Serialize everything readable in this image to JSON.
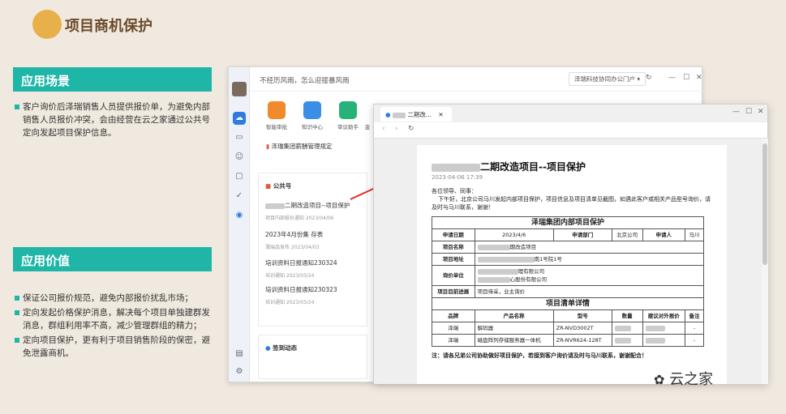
{
  "header": {
    "title": "项目商机保护"
  },
  "scenario": {
    "heading": "应用场景",
    "bullets": [
      "客户询价后泽瑞销售人员提供报价单，为避免内部销售人员报价冲突，会由经营在云之家通过公共号定向发起项目保护信息。"
    ]
  },
  "value": {
    "heading": "应用价值",
    "bullets": [
      "保证公司报价规范，避免内部报价扰乱市场；",
      "定向发起价格保护消息，解决每个项目单独建群发消息，群组利用率不高，减少管理群组的精力；",
      "定向项目保护，更有利于项目销售阶段的保密，避免泄露商机。"
    ]
  },
  "app": {
    "slogan": "不经历风雨，怎么迎接暴风雨",
    "org": "泽瑞科技协同办公门户",
    "apps": [
      "智能审批",
      "知识中心",
      "审议助手",
      "金"
    ],
    "notice": "泽瑞集团薪酬管理规定",
    "public_account": "公共号",
    "items": [
      {
        "title": "二期改造项目--项目保护",
        "sub": "项目内部报价通知  2023/04/06"
      },
      {
        "title": "2023年4月份集  存表",
        "sub": "薄瑞品发布  2023/04/03"
      },
      {
        "title": "培训资料日报通知230324",
        "sub": "培训通知  2023/03/24"
      },
      {
        "title": "培训资料日报通知230323",
        "sub": "培训通知  2023/03/24"
      }
    ],
    "checkin": "签到动态"
  },
  "popup": {
    "tab": "二期改...",
    "doc_title": "二期改造项目--项目保护",
    "doc_date": "2023-04-06 17:39",
    "greeting": "各位领导、同事：",
    "body": "下午好，北京公司马川发起内部项目保护，项目信息及项目清单见截图，如遇此客户或相关产品型号询价，请及时与马川联系，谢谢！",
    "table_title": "泽瑞集团内部项目保护",
    "labels": {
      "apply_date": "申请日期",
      "date": "2023/4/6",
      "dept": "申请部门",
      "dept_val": "北京公司",
      "applicant": "申请人",
      "applicant_val": "马川",
      "project_name": "项目名称",
      "project_name_val": "期改造项目",
      "project_addr": "项目地址",
      "project_addr_val": "南1号院1号",
      "inquiry": "询价单位",
      "inquiry_val1": "理有限公司",
      "inquiry_val2": "心股份有限公司",
      "progress": "项目目前进展",
      "progress_val": "项目待采，业主询价",
      "list_title": "项目清单详情",
      "col_brand": "品牌",
      "col_product": "产品名称",
      "col_model": "型号",
      "col_qty": "数量",
      "col_price": "建议对外报价",
      "col_note": "备注"
    },
    "rows": [
      {
        "brand": "泽瑞",
        "product": "解码器",
        "model": "ZR-NVD3002T",
        "note": "-"
      },
      {
        "brand": "泽瑞",
        "product": "磁盘阵列存储服务器一体机",
        "model": "ZR-NVR624-128T",
        "note": "-"
      }
    ],
    "footer_note": "注：请各兄弟公司协助做好项目保护，若接到客户询价请及时与马川联系，谢谢配合！"
  },
  "watermark": "云之家"
}
